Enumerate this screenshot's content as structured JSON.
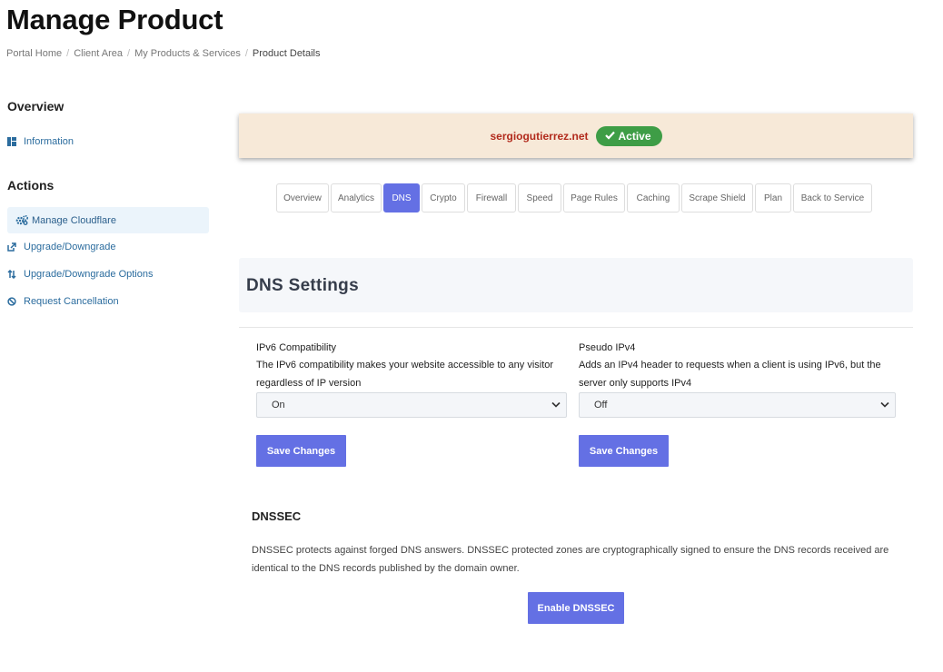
{
  "page": {
    "title": "Manage Product"
  },
  "breadcrumb": [
    "Portal Home",
    "Client Area",
    "My Products & Services",
    "Product Details"
  ],
  "sidebar": {
    "overview_heading": "Overview",
    "overview_items": [
      {
        "label": "Information",
        "icon": "info-grid-icon"
      }
    ],
    "actions_heading": "Actions",
    "actions_items": [
      {
        "label": "Manage Cloudflare",
        "icon": "gears-icon",
        "active": true
      },
      {
        "label": "Upgrade/Downgrade",
        "icon": "external-link-icon"
      },
      {
        "label": "Upgrade/Downgrade Options",
        "icon": "sort-arrows-icon"
      },
      {
        "label": "Request Cancellation",
        "icon": "ban-icon"
      }
    ]
  },
  "domain": {
    "name": "sergiogutierrez.net",
    "status": "Active",
    "status_color": "#3e9d46",
    "name_color": "#b22b1d"
  },
  "tabs": [
    {
      "label": "Overview"
    },
    {
      "label": "Analytics"
    },
    {
      "label": "DNS",
      "active": true
    },
    {
      "label": "Crypto"
    },
    {
      "label": "Firewall"
    },
    {
      "label": "Speed"
    },
    {
      "label": "Page Rules"
    },
    {
      "label": "Caching"
    },
    {
      "label": "Scrape Shield"
    },
    {
      "label": "Plan"
    },
    {
      "label": "Back to Service"
    }
  ],
  "settings": {
    "heading": "DNS Settings",
    "ipv6": {
      "label": "IPv6 Compatibility",
      "desc_line1": "The IPv6 compatibility makes your website accessible to any visitor",
      "desc_line2": "regardless of IP version",
      "value": "On",
      "button": "Save Changes"
    },
    "pseudo_ipv4": {
      "label": "Pseudo IPv4",
      "desc_line1": "Adds an IPv4 header to requests when a client is using IPv6, but the",
      "desc_line2": "server only supports IPv4",
      "value": "Off",
      "button": "Save Changes"
    }
  },
  "dnssec": {
    "title": "DNSSEC",
    "desc_line1": "DNSSEC protects against forged DNS answers. DNSSEC protected zones are cryptographically signed to ensure the DNS records received are",
    "desc_line2": "identical to the DNS records published by the domain owner.",
    "button": "Enable DNSSEC"
  },
  "colors": {
    "accent": "#6470e4",
    "link": "#2b6c9e"
  }
}
